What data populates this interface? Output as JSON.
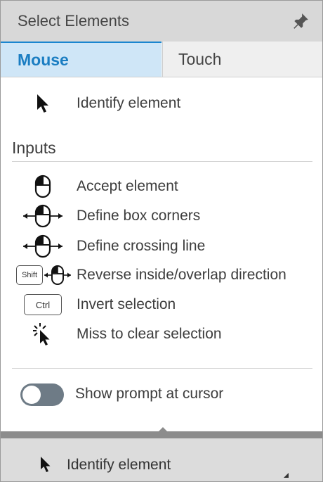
{
  "panel": {
    "title": "Select Elements"
  },
  "tabs": [
    {
      "label": "Mouse",
      "active": true
    },
    {
      "label": "Touch",
      "active": false
    }
  ],
  "primary": {
    "icon": "cursor-arrow-icon",
    "label": "Identify element"
  },
  "inputs": {
    "heading": "Inputs",
    "items": [
      {
        "icon": "mouse-left-click-icon",
        "label": "Accept element"
      },
      {
        "icon": "mouse-drag-horizontal-icon",
        "label": "Define box corners"
      },
      {
        "icon": "mouse-drag-horizontal-icon",
        "label": "Define crossing line"
      },
      {
        "icon": "shift-mouse-drag-icon",
        "key": "Shift",
        "label": "Reverse inside/overlap direction"
      },
      {
        "icon": "ctrl-key-icon",
        "key": "Ctrl",
        "label": "Invert selection"
      },
      {
        "icon": "cursor-burst-icon",
        "label": "Miss to clear selection"
      }
    ]
  },
  "toggle": {
    "label": "Show prompt at cursor",
    "on": false
  },
  "footer": {
    "icon": "cursor-arrow-icon",
    "label": "Identify element"
  },
  "colors": {
    "accent": "#1a7dc2",
    "tab_active_bg": "#cfe6f7",
    "toggle_off": "#6e7b86"
  }
}
